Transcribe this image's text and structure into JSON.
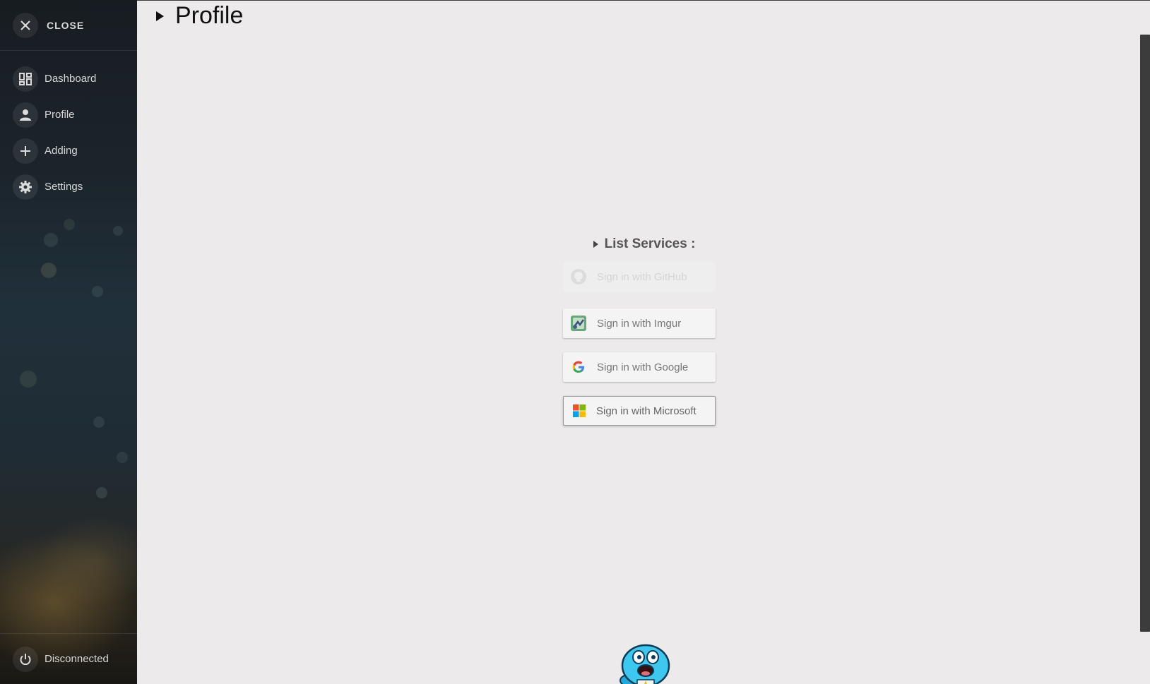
{
  "sidebar": {
    "close": {
      "label": "CLOSE",
      "icon": "close-icon"
    },
    "items": [
      {
        "label": "Dashboard",
        "icon": "dashboard-icon"
      },
      {
        "label": "Profile",
        "icon": "person-icon"
      },
      {
        "label": "Adding",
        "icon": "plus-icon"
      },
      {
        "label": "Settings",
        "icon": "gear-icon"
      }
    ],
    "status": {
      "label": "Disconnected",
      "icon": "power-icon"
    }
  },
  "main": {
    "title": "Profile",
    "services": {
      "heading": "List Services :",
      "buttons": [
        {
          "label": "Sign in with GitHub",
          "icon": "github-icon",
          "state": "disabled"
        },
        {
          "label": "Sign in with Imgur",
          "icon": "imgur-icon"
        },
        {
          "label": "Sign in with Google",
          "icon": "google-icon"
        },
        {
          "label": "Sign in with Microsoft",
          "icon": "microsoft-icon"
        }
      ]
    }
  },
  "colors": {
    "page_bg": "#eceaea",
    "sidebar_text": "#d8d8d8",
    "button_bg": "#f4f4f4",
    "microsoft_red": "#f25022",
    "microsoft_green": "#7fba00",
    "microsoft_blue": "#00a4ef",
    "microsoft_yellow": "#ffb900"
  }
}
